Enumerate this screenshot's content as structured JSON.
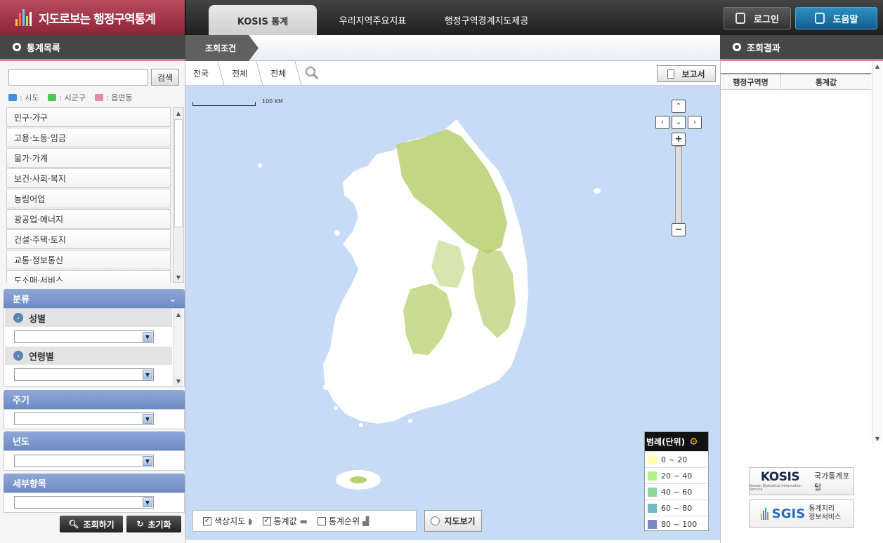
{
  "app": {
    "title": "지도로보는 행정구역통계"
  },
  "nav": {
    "tabs": [
      "KOSIS 통계",
      "우리지역주요지표",
      "행정구역경계지도제공"
    ],
    "login": "로그인",
    "help": "도움말"
  },
  "left": {
    "heading": "통계목록",
    "search_button": "검색",
    "search_value": "",
    "levels": [
      {
        "label": ": 시도",
        "color": "#3f8fd9"
      },
      {
        "label": ": 시군구",
        "color": "#4cc84c"
      },
      {
        "label": ": 읍면동",
        "color": "#e88aa0"
      }
    ],
    "categories": [
      "인구·가구",
      "고용·노동·임금",
      "물가·가계",
      "보건·사회·복지",
      "농림어업",
      "광공업·에너지",
      "건설·주택·토지",
      "교통·정보통신",
      "도소매·서비스"
    ],
    "sections": {
      "classification": "분류",
      "gender": "성별",
      "age": "연령별",
      "period": "주기",
      "year": "년도",
      "detail": "세부항목"
    },
    "query_button": "조회하기",
    "reset_button": "초기화"
  },
  "conditions": {
    "tab": "조회조건",
    "breadcrumb": [
      "전국",
      "전체",
      "전체"
    ],
    "report_button": "보고서"
  },
  "map": {
    "scale_label": "100 KM",
    "legend": {
      "title": "범례(단위)",
      "ranges": [
        {
          "label": "0 ~ 20",
          "color": "#ffffa8"
        },
        {
          "label": "20 ~ 40",
          "color": "#b3f08c"
        },
        {
          "label": "40 ~ 60",
          "color": "#8fd49a"
        },
        {
          "label": "60 ~ 80",
          "color": "#74b9c8"
        },
        {
          "label": "80 ~ 100",
          "color": "#7a86c0"
        }
      ]
    },
    "options": [
      {
        "label": "색상지도",
        "checked": true
      },
      {
        "label": "통계값",
        "checked": true
      },
      {
        "label": "통계순위",
        "checked": false
      }
    ],
    "map_view_button": "지도보기"
  },
  "right": {
    "heading": "조회결과",
    "columns": [
      "행정구역명",
      "통계값"
    ],
    "kosis_logo": "KOSIS",
    "kosis_text": "국가통계포털",
    "kosis_sub": "Korean Statistical Information Service",
    "sgis_logo": "SGIS",
    "sgis_text": "통계지리 정보서비스"
  },
  "colors": {
    "brand": "#a53750",
    "panel_blue": "#7a95cc",
    "map_water": "#c6dcf6",
    "map_fill": "#b8cf6e"
  }
}
